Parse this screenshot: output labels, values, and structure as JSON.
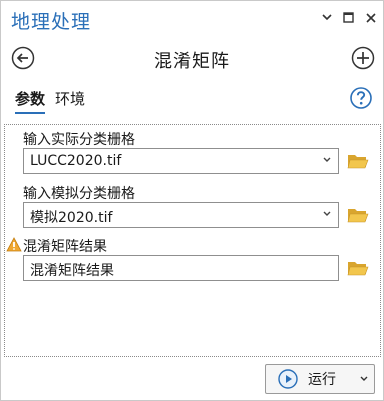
{
  "window": {
    "title": "地理处理"
  },
  "tool": {
    "title": "混淆矩阵"
  },
  "tabs": [
    {
      "label": "参数",
      "active": true
    },
    {
      "label": "环境",
      "active": false
    }
  ],
  "params": {
    "actual_raster": {
      "label": "输入实际分类栅格",
      "value": "LUCC2020.tif"
    },
    "simulated_raster": {
      "label": "输入模拟分类栅格",
      "value": "模拟2020.tif"
    },
    "output": {
      "label": "混淆矩阵结果",
      "value": "混淆矩阵结果",
      "warning": true
    }
  },
  "footer": {
    "run_label": "运行"
  },
  "colors": {
    "accent": "#2a6fb8",
    "warning": "#e8a02a",
    "folder": "#e3b341"
  }
}
